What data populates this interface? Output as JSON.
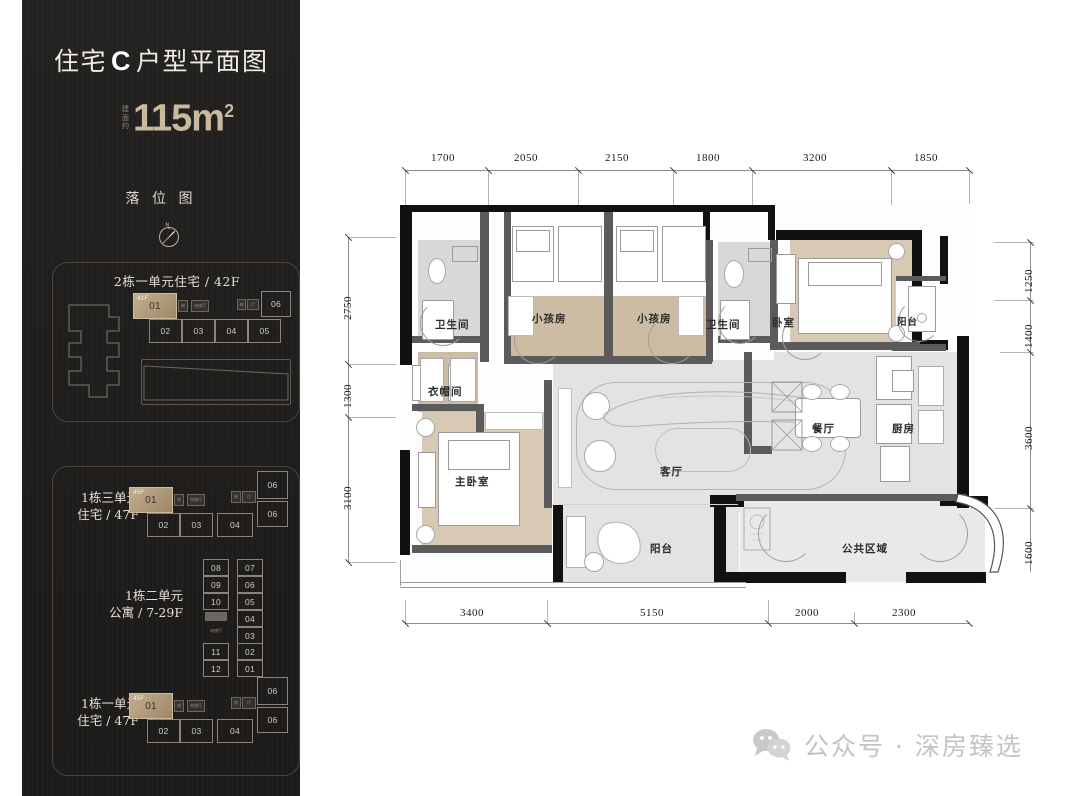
{
  "header": {
    "title_prefix": "住宅",
    "title_letter": "C",
    "title_suffix": "户型平面图",
    "area_prefix_line1": "建面",
    "area_prefix_line2": "约",
    "area_value": "115m",
    "area_unit_sup": "2"
  },
  "location_map": {
    "title": "落 位 图",
    "compass_label": "N"
  },
  "blocks": [
    {
      "heading": "2栋一单元住宅 / 42F",
      "floor_badge": "41F",
      "units": [
        "01",
        "02",
        "03",
        "04",
        "05",
        "06"
      ]
    },
    {
      "label_line1": "1栋三单元",
      "label_line2": "住宅 / 47F",
      "floor_badge": "45F",
      "units": [
        "01",
        "02",
        "03",
        "04",
        "06",
        "06"
      ]
    },
    {
      "label_line1": "1栋二单元",
      "label_line2": "公寓 / 7-29F",
      "units_left": [
        "08",
        "09",
        "10",
        "11",
        "12"
      ],
      "units_right": [
        "07",
        "06",
        "05",
        "04",
        "03",
        "02",
        "01"
      ]
    },
    {
      "label_line1": "1栋一单元",
      "label_line2": "住宅 / 47F",
      "floor_badge": "45F",
      "units": [
        "01",
        "02",
        "03",
        "04",
        "06",
        "06"
      ]
    }
  ],
  "floorplan": {
    "dimensions_top": [
      "1700",
      "2050",
      "2150",
      "1800",
      "3200",
      "1850"
    ],
    "dimensions_bottom": [
      "3400",
      "5150",
      "2000",
      "2300"
    ],
    "dimensions_left": [
      "2750",
      "1300",
      "3100"
    ],
    "dimensions_right": [
      "1250",
      "1400",
      "3600",
      "1600"
    ],
    "rooms": {
      "bath_left": "卫生间",
      "kid_room_1": "小孩房",
      "kid_room_2": "小孩房",
      "bath_right": "卫生间",
      "bedroom": "卧室",
      "balcony_right": "阳台",
      "wardrobe": "衣帽间",
      "master_bedroom": "主卧室",
      "living_room": "客厅",
      "balcony_main": "阳台",
      "dining_room": "餐厅",
      "kitchen": "厨房",
      "public_area": "公共区域"
    }
  },
  "watermark": {
    "icon": "wechat-icon",
    "text": "公众号 · 深房臻选"
  },
  "colors": {
    "panel_bg": "#201e1c",
    "accent_gold": "#c9b99e",
    "highlight_unit": "#b9a489",
    "watermark_grey": "#c3c3c3"
  }
}
